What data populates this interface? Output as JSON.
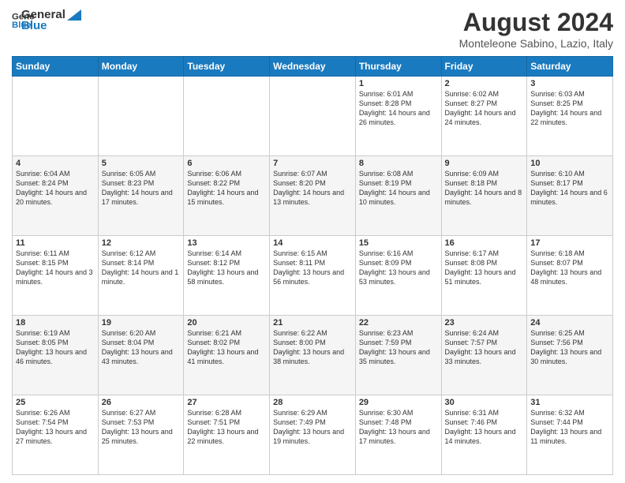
{
  "logo": {
    "line1": "General",
    "line2": "Blue"
  },
  "title": "August 2024",
  "location": "Monteleone Sabino, Lazio, Italy",
  "weekdays": [
    "Sunday",
    "Monday",
    "Tuesday",
    "Wednesday",
    "Thursday",
    "Friday",
    "Saturday"
  ],
  "weeks": [
    [
      {
        "day": "",
        "info": ""
      },
      {
        "day": "",
        "info": ""
      },
      {
        "day": "",
        "info": ""
      },
      {
        "day": "",
        "info": ""
      },
      {
        "day": "1",
        "info": "Sunrise: 6:01 AM\nSunset: 8:28 PM\nDaylight: 14 hours and 26 minutes."
      },
      {
        "day": "2",
        "info": "Sunrise: 6:02 AM\nSunset: 8:27 PM\nDaylight: 14 hours and 24 minutes."
      },
      {
        "day": "3",
        "info": "Sunrise: 6:03 AM\nSunset: 8:25 PM\nDaylight: 14 hours and 22 minutes."
      }
    ],
    [
      {
        "day": "4",
        "info": "Sunrise: 6:04 AM\nSunset: 8:24 PM\nDaylight: 14 hours and 20 minutes."
      },
      {
        "day": "5",
        "info": "Sunrise: 6:05 AM\nSunset: 8:23 PM\nDaylight: 14 hours and 17 minutes."
      },
      {
        "day": "6",
        "info": "Sunrise: 6:06 AM\nSunset: 8:22 PM\nDaylight: 14 hours and 15 minutes."
      },
      {
        "day": "7",
        "info": "Sunrise: 6:07 AM\nSunset: 8:20 PM\nDaylight: 14 hours and 13 minutes."
      },
      {
        "day": "8",
        "info": "Sunrise: 6:08 AM\nSunset: 8:19 PM\nDaylight: 14 hours and 10 minutes."
      },
      {
        "day": "9",
        "info": "Sunrise: 6:09 AM\nSunset: 8:18 PM\nDaylight: 14 hours and 8 minutes."
      },
      {
        "day": "10",
        "info": "Sunrise: 6:10 AM\nSunset: 8:17 PM\nDaylight: 14 hours and 6 minutes."
      }
    ],
    [
      {
        "day": "11",
        "info": "Sunrise: 6:11 AM\nSunset: 8:15 PM\nDaylight: 14 hours and 3 minutes."
      },
      {
        "day": "12",
        "info": "Sunrise: 6:12 AM\nSunset: 8:14 PM\nDaylight: 14 hours and 1 minute."
      },
      {
        "day": "13",
        "info": "Sunrise: 6:14 AM\nSunset: 8:12 PM\nDaylight: 13 hours and 58 minutes."
      },
      {
        "day": "14",
        "info": "Sunrise: 6:15 AM\nSunset: 8:11 PM\nDaylight: 13 hours and 56 minutes."
      },
      {
        "day": "15",
        "info": "Sunrise: 6:16 AM\nSunset: 8:09 PM\nDaylight: 13 hours and 53 minutes."
      },
      {
        "day": "16",
        "info": "Sunrise: 6:17 AM\nSunset: 8:08 PM\nDaylight: 13 hours and 51 minutes."
      },
      {
        "day": "17",
        "info": "Sunrise: 6:18 AM\nSunset: 8:07 PM\nDaylight: 13 hours and 48 minutes."
      }
    ],
    [
      {
        "day": "18",
        "info": "Sunrise: 6:19 AM\nSunset: 8:05 PM\nDaylight: 13 hours and 46 minutes."
      },
      {
        "day": "19",
        "info": "Sunrise: 6:20 AM\nSunset: 8:04 PM\nDaylight: 13 hours and 43 minutes."
      },
      {
        "day": "20",
        "info": "Sunrise: 6:21 AM\nSunset: 8:02 PM\nDaylight: 13 hours and 41 minutes."
      },
      {
        "day": "21",
        "info": "Sunrise: 6:22 AM\nSunset: 8:00 PM\nDaylight: 13 hours and 38 minutes."
      },
      {
        "day": "22",
        "info": "Sunrise: 6:23 AM\nSunset: 7:59 PM\nDaylight: 13 hours and 35 minutes."
      },
      {
        "day": "23",
        "info": "Sunrise: 6:24 AM\nSunset: 7:57 PM\nDaylight: 13 hours and 33 minutes."
      },
      {
        "day": "24",
        "info": "Sunrise: 6:25 AM\nSunset: 7:56 PM\nDaylight: 13 hours and 30 minutes."
      }
    ],
    [
      {
        "day": "25",
        "info": "Sunrise: 6:26 AM\nSunset: 7:54 PM\nDaylight: 13 hours and 27 minutes."
      },
      {
        "day": "26",
        "info": "Sunrise: 6:27 AM\nSunset: 7:53 PM\nDaylight: 13 hours and 25 minutes."
      },
      {
        "day": "27",
        "info": "Sunrise: 6:28 AM\nSunset: 7:51 PM\nDaylight: 13 hours and 22 minutes."
      },
      {
        "day": "28",
        "info": "Sunrise: 6:29 AM\nSunset: 7:49 PM\nDaylight: 13 hours and 19 minutes."
      },
      {
        "day": "29",
        "info": "Sunrise: 6:30 AM\nSunset: 7:48 PM\nDaylight: 13 hours and 17 minutes."
      },
      {
        "day": "30",
        "info": "Sunrise: 6:31 AM\nSunset: 7:46 PM\nDaylight: 13 hours and 14 minutes."
      },
      {
        "day": "31",
        "info": "Sunrise: 6:32 AM\nSunset: 7:44 PM\nDaylight: 13 hours and 11 minutes."
      }
    ]
  ]
}
